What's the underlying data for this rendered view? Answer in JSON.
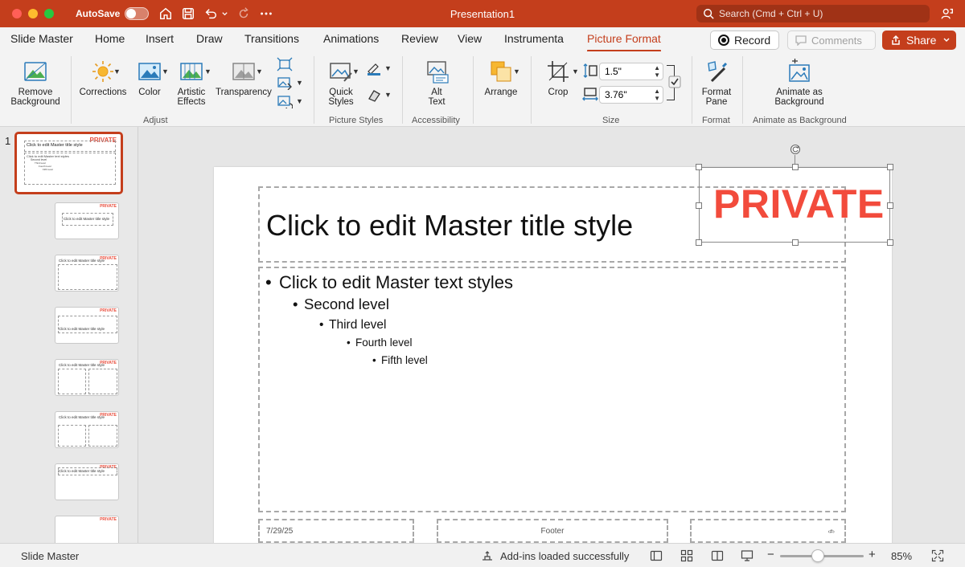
{
  "window": {
    "title": "Presentation1",
    "autosave_label": "AutoSave",
    "search_placeholder": "Search (Cmd + Ctrl + U)"
  },
  "tabs": [
    {
      "label": "Slide Master"
    },
    {
      "label": "Home"
    },
    {
      "label": "Insert"
    },
    {
      "label": "Draw"
    },
    {
      "label": "Transitions"
    },
    {
      "label": "Animations"
    },
    {
      "label": "Review"
    },
    {
      "label": "View"
    },
    {
      "label": "Instrumenta"
    },
    {
      "label": "Picture Format"
    }
  ],
  "actions": {
    "record": "Record",
    "comments": "Comments",
    "share": "Share"
  },
  "ribbon": {
    "remove_background_1": "Remove",
    "remove_background_2": "Background",
    "corrections": "Corrections",
    "color": "Color",
    "artistic_effects_1": "Artistic",
    "artistic_effects_2": "Effects",
    "transparency": "Transparency",
    "adjust_group": "Adjust",
    "quick_styles_1": "Quick",
    "quick_styles_2": "Styles",
    "picture_styles_group": "Picture Styles",
    "alt_text_1": "Alt",
    "alt_text_2": "Text",
    "accessibility_group": "Accessibility",
    "arrange": "Arrange",
    "crop": "Crop",
    "height_value": "1.5\"",
    "width_value": "3.76\"",
    "size_group": "Size",
    "format_pane_1": "Format",
    "format_pane_2": "Pane",
    "format_group": "Format",
    "animate_bg_1": "Animate as",
    "animate_bg_2": "Background",
    "animate_bg_group": "Animate as Background"
  },
  "thumbnails": {
    "master_number": "1",
    "private_tag": "PRIVATE",
    "thumb_title": "Click to edit Master title style",
    "thumb_body_1": "Click to edit Master text styles",
    "thumb_body_2": "Second level",
    "thumb_body_3": "Third level",
    "thumb_body_4": "Fourth level",
    "thumb_body_5": "Fifth level"
  },
  "slide": {
    "title": "Click to edit Master title style",
    "level1": "Click to edit Master text styles",
    "level2": "Second level",
    "level3": "Third level",
    "level4": "Fourth level",
    "level5": "Fifth level",
    "date": "7/29/25",
    "footer": "Footer",
    "slide_number": "‹#›",
    "private_label": "PRIVATE"
  },
  "status": {
    "view_name": "Slide Master",
    "addins": "Add-ins loaded successfully",
    "zoom": "85%",
    "zoom_fraction": 0.45
  },
  "colors": {
    "accent": "#c43e1c",
    "private_red": "#f24b3c"
  }
}
